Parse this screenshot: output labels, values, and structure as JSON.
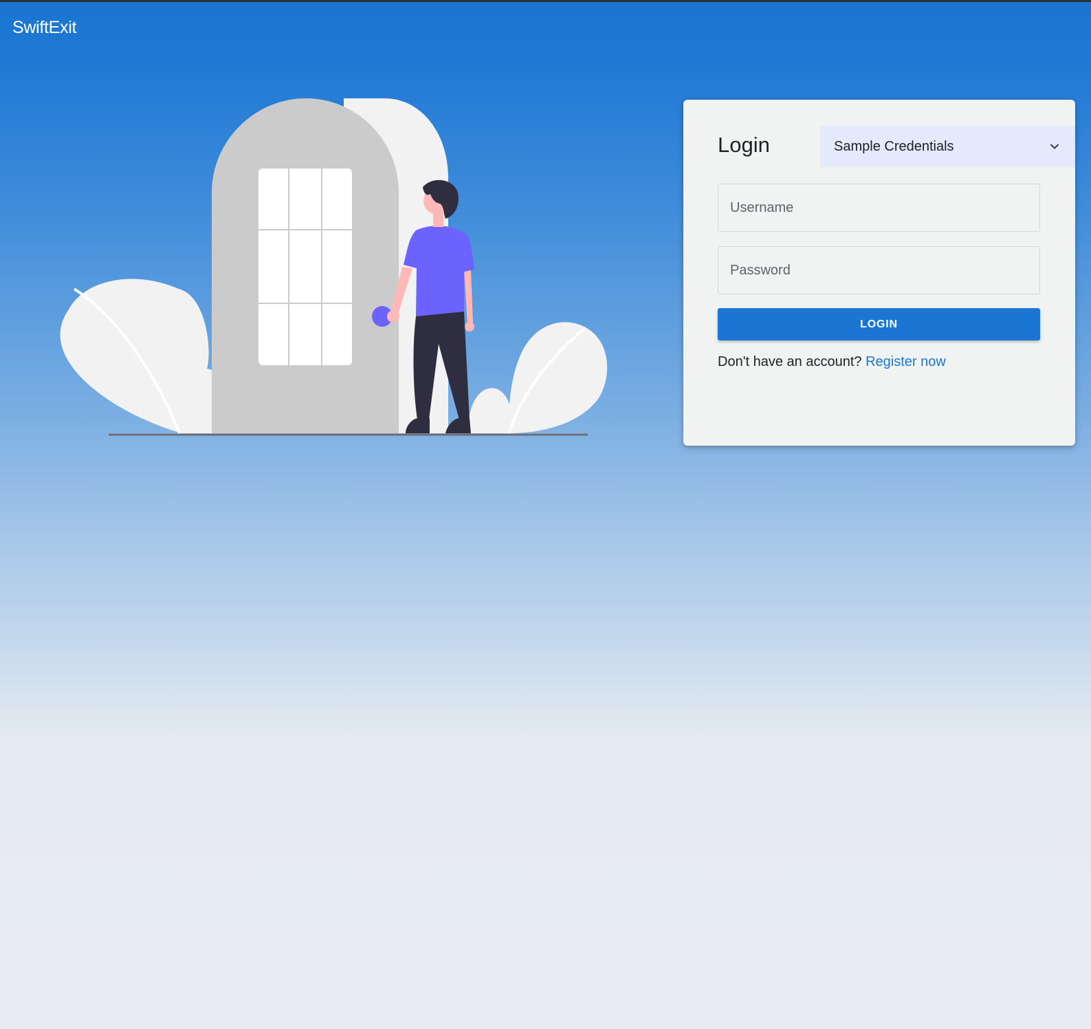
{
  "app": {
    "brand": "SwiftExit"
  },
  "login_card": {
    "title": "Login",
    "credentials_select": {
      "selected": "Sample Credentials"
    },
    "username": {
      "placeholder": "Username",
      "value": ""
    },
    "password": {
      "placeholder": "Password",
      "value": ""
    },
    "login_button": "LOGIN",
    "signup_prompt": "Don't have an account?",
    "signup_link": "Register now"
  },
  "colors": {
    "primary": "#1a76d2",
    "card_background": "#f1f3f3",
    "select_background": "#e4e9fb",
    "illustration_accent": "#6c63ff",
    "illustration_dark": "#2f2e41"
  },
  "icons": {
    "select_arrow": "chevron-down-icon"
  }
}
